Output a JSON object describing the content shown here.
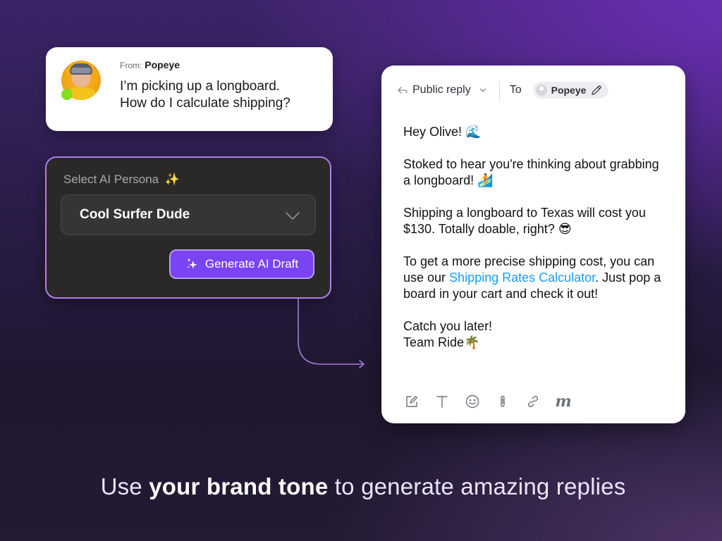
{
  "message": {
    "from_label": "From:",
    "from_name": "Popeye",
    "text_line1": "I’m picking up a longboard.",
    "text_line2": "How do I calculate shipping?",
    "avatar_icon": "user-photo",
    "status": "online",
    "status_color": "#80e11a"
  },
  "persona": {
    "label": "Select AI Persona",
    "label_emoji": "✨",
    "selected": "Cool Surfer Dude",
    "generate_label": "Generate AI Draft",
    "accent_color": "#7a43f3",
    "border_color": "#b07ee8"
  },
  "reply": {
    "mode": "Public reply",
    "to_label": "To",
    "recipient": "Popeye",
    "body": {
      "greeting": "Hey Olive! 🌊",
      "p1": "Stoked to hear you're thinking about grabbing a longboard!  🏄",
      "p2": "Shipping a longboard to Texas will cost you $130. Totally doable, right? 😎",
      "p3_before": "To get a more precise shipping cost, you can use our ",
      "p3_link": "Shipping Rates Calculator",
      "p3_after": ". Just pop a board in your cart and check it out!",
      "signoff1": "Catch you later!",
      "signoff2": "Team Ride🌴"
    },
    "link_color": "#1d9bf0",
    "toolbar": [
      "compose-icon",
      "text-format-icon",
      "emoji-icon",
      "attachment-icon",
      "link-icon",
      "macro-m-icon"
    ],
    "toolbar_m_glyph": "m"
  },
  "caption": {
    "before": "Use ",
    "bold": "your brand tone",
    "after": " to generate amazing replies"
  }
}
